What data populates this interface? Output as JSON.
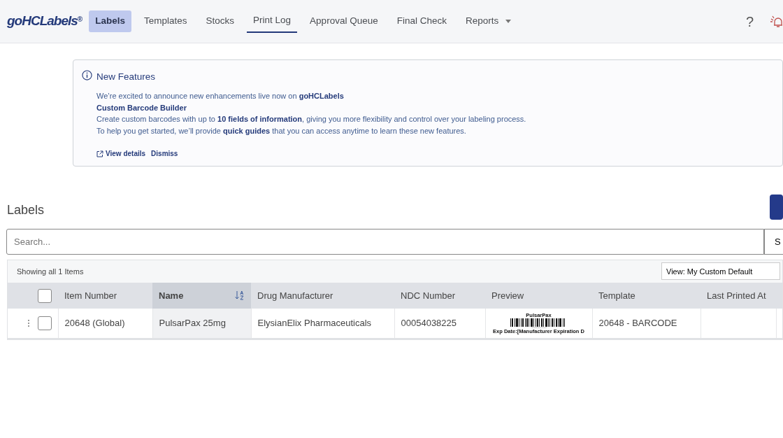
{
  "brand": {
    "logo": "goHCLabels",
    "mark": "®"
  },
  "nav": [
    {
      "label": "Labels",
      "selected": true,
      "underlined": false,
      "dropdown": false
    },
    {
      "label": "Templates",
      "selected": false,
      "underlined": false,
      "dropdown": false
    },
    {
      "label": "Stocks",
      "selected": false,
      "underlined": false,
      "dropdown": false
    },
    {
      "label": "Print Log",
      "selected": false,
      "underlined": true,
      "dropdown": false
    },
    {
      "label": "Approval Queue",
      "selected": false,
      "underlined": false,
      "dropdown": false
    },
    {
      "label": "Final Check",
      "selected": false,
      "underlined": false,
      "dropdown": false
    },
    {
      "label": "Reports",
      "selected": false,
      "underlined": false,
      "dropdown": true
    }
  ],
  "help": "?",
  "notice": {
    "title": "New Features",
    "lines": [
      "We’re excited to announce new enhancements live now on **goHCLabels**",
      "**Custom Barcode Builder**",
      "Create custom barcodes with up to **10 fields of information**, giving you more flexibility and control over your labeling process.",
      "To help you get started, we’ll provide **quick guides** that you can access anytime to learn these new features."
    ],
    "links": [
      "View details",
      "Dismiss"
    ]
  },
  "page_title": "Labels",
  "search": {
    "placeholder": "Search...",
    "button": "S"
  },
  "table": {
    "summary": "Showing all 1 Items",
    "view": "View: My Custom Default",
    "columns": [
      {
        "label": "Item Number",
        "sorted": false
      },
      {
        "label": "Name",
        "sorted": true
      },
      {
        "label": "Drug Manufacturer",
        "sorted": false
      },
      {
        "label": "NDC Number",
        "sorted": false
      },
      {
        "label": "Preview",
        "sorted": false
      },
      {
        "label": "Template",
        "sorted": false
      },
      {
        "label": "Last Printed At",
        "sorted": false
      }
    ],
    "header_checked": false,
    "rows": [
      {
        "checked": false,
        "item_number": "20648 (Global)",
        "name": "PulsarPax 25mg",
        "manufacturer": "ElysianElix Pharmaceuticals",
        "ndc": "00054038225",
        "preview": {
          "title": "PulsarPax",
          "footer": "Exp Date:[Manufacturer Expiration D"
        },
        "template": "20648 - BARCODE",
        "last_printed": ""
      }
    ]
  }
}
